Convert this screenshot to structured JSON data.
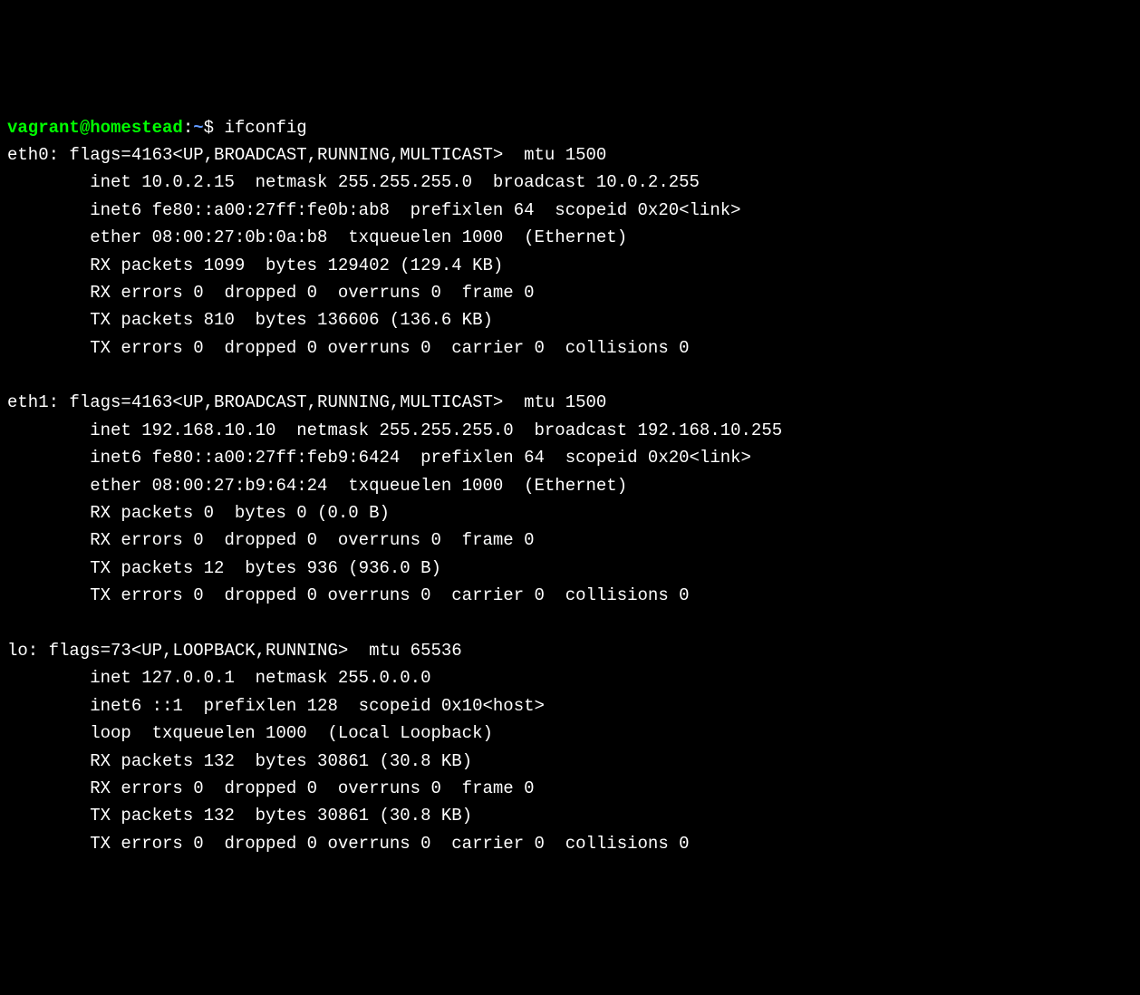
{
  "prompt": {
    "user_host": "vagrant@homestead",
    "colon": ":",
    "path": "~",
    "dollar": "$ ",
    "command": "ifconfig"
  },
  "interfaces": [
    {
      "header": "eth0: flags=4163<UP,BROADCAST,RUNNING,MULTICAST>  mtu 1500",
      "lines": [
        "        inet 10.0.2.15  netmask 255.255.255.0  broadcast 10.0.2.255",
        "        inet6 fe80::a00:27ff:fe0b:ab8  prefixlen 64  scopeid 0x20<link>",
        "        ether 08:00:27:0b:0a:b8  txqueuelen 1000  (Ethernet)",
        "        RX packets 1099  bytes 129402 (129.4 KB)",
        "        RX errors 0  dropped 0  overruns 0  frame 0",
        "        TX packets 810  bytes 136606 (136.6 KB)",
        "        TX errors 0  dropped 0 overruns 0  carrier 0  collisions 0"
      ]
    },
    {
      "header": "eth1: flags=4163<UP,BROADCAST,RUNNING,MULTICAST>  mtu 1500",
      "lines": [
        "        inet 192.168.10.10  netmask 255.255.255.0  broadcast 192.168.10.255",
        "        inet6 fe80::a00:27ff:feb9:6424  prefixlen 64  scopeid 0x20<link>",
        "        ether 08:00:27:b9:64:24  txqueuelen 1000  (Ethernet)",
        "        RX packets 0  bytes 0 (0.0 B)",
        "        RX errors 0  dropped 0  overruns 0  frame 0",
        "        TX packets 12  bytes 936 (936.0 B)",
        "        TX errors 0  dropped 0 overruns 0  carrier 0  collisions 0"
      ]
    },
    {
      "header": "lo: flags=73<UP,LOOPBACK,RUNNING>  mtu 65536",
      "lines": [
        "        inet 127.0.0.1  netmask 255.0.0.0",
        "        inet6 ::1  prefixlen 128  scopeid 0x10<host>",
        "        loop  txqueuelen 1000  (Local Loopback)",
        "        RX packets 132  bytes 30861 (30.8 KB)",
        "        RX errors 0  dropped 0  overruns 0  frame 0",
        "        TX packets 132  bytes 30861 (30.8 KB)",
        "        TX errors 0  dropped 0 overruns 0  carrier 0  collisions 0"
      ]
    }
  ]
}
